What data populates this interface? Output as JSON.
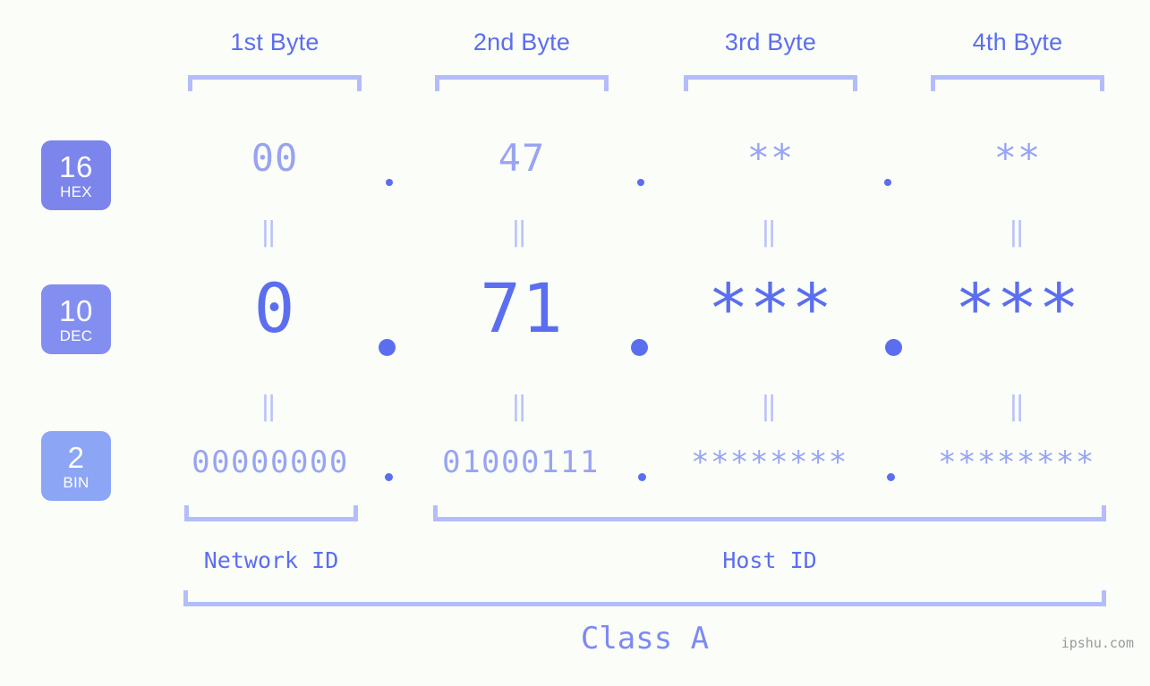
{
  "bytes": [
    {
      "label": "1st Byte"
    },
    {
      "label": "2nd Byte"
    },
    {
      "label": "3rd Byte"
    },
    {
      "label": "4th Byte"
    }
  ],
  "bases": [
    {
      "num": "16",
      "sub": "HEX",
      "color": "#7b85ec"
    },
    {
      "num": "10",
      "sub": "DEC",
      "color": "#838ff0"
    },
    {
      "num": "2",
      "sub": "BIN",
      "color": "#8ca5f5"
    }
  ],
  "rows": {
    "hex": {
      "values": [
        "00",
        "47",
        "**",
        "**"
      ]
    },
    "dec": {
      "values": [
        "0",
        "71",
        "***",
        "***"
      ]
    },
    "bin": {
      "values": [
        "00000000",
        "01000111",
        "********",
        "********"
      ]
    }
  },
  "separator": ".",
  "equality_marker": "‖",
  "segments": {
    "network_id": "Network ID",
    "host_id": "Host ID",
    "class": "Class A"
  },
  "watermark": "ipshu.com",
  "colors": {
    "background": "#fbfdf8",
    "accent": "#5b6ef0",
    "accent_light": "#98a4f2",
    "bracket": "#b3bdfb",
    "parallel": "#b9c2fb",
    "watermark": "#9a9a9a"
  }
}
